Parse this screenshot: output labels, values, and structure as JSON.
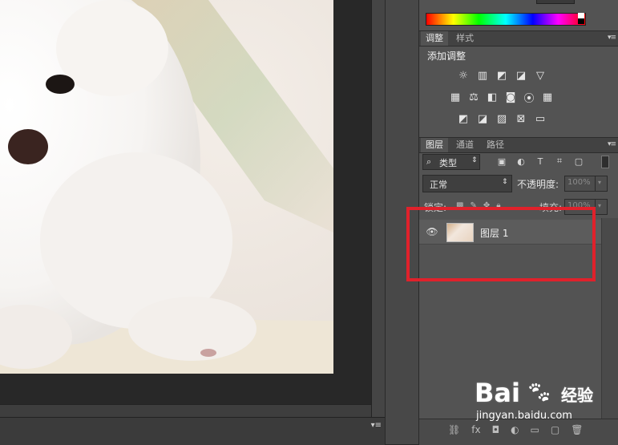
{
  "color_panel": {},
  "adjustments": {
    "tabs": [
      {
        "label": "调整",
        "active": true
      },
      {
        "label": "样式",
        "active": false
      }
    ],
    "title": "添加调整",
    "icons_row1": [
      "brightness-contrast-icon",
      "levels-icon",
      "curves-icon",
      "exposure-icon",
      "gradient-triangle-icon"
    ],
    "icons_row2": [
      "vibrance-icon",
      "color-balance-icon",
      "black-white-icon",
      "photo-filter-icon",
      "channel-mixer-icon",
      "color-lookup-icon"
    ],
    "icons_row3": [
      "invert-icon",
      "posterize-icon",
      "threshold-icon",
      "selective-color-icon",
      "gradient-map-icon"
    ]
  },
  "layers": {
    "tabs": [
      {
        "label": "图层",
        "active": true
      },
      {
        "label": "通道",
        "active": false
      },
      {
        "label": "路径",
        "active": false
      }
    ],
    "filter_kind": "类型",
    "blend_mode": "正常",
    "opacity_label": "不透明度:",
    "opacity_value": "100%",
    "lock_label": "锁定:",
    "fill_label": "填充:",
    "fill_value": "100%",
    "layer_name": "图层 1"
  },
  "watermark": {
    "brand": "Bai",
    "brand_suffix": "经验",
    "url": "jingyan.baidu.com"
  },
  "colors": {
    "panel_bg": "#535353",
    "canvas_bg": "#282828",
    "highlight": "#e0212b"
  }
}
